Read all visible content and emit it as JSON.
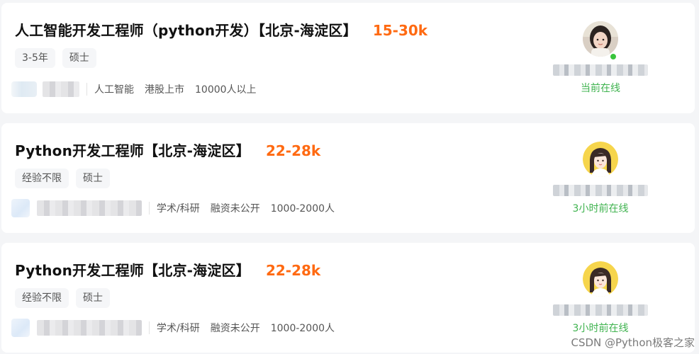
{
  "jobs": [
    {
      "title": "人工智能开发工程师（python开发）【北京-海淀区】",
      "salary": "15-30k",
      "tags": [
        "3-5年",
        "硕士"
      ],
      "company_meta": [
        "人工智能",
        "港股上市",
        "10000人以上"
      ],
      "recruiter_status": "当前在线",
      "recruiter_online": true
    },
    {
      "title": "Python开发工程师【北京-海淀区】",
      "salary": "22-28k",
      "tags": [
        "经验不限",
        "硕士"
      ],
      "company_meta": [
        "学术/科研",
        "融资未公开",
        "1000-2000人"
      ],
      "recruiter_status": "3小时前在线",
      "recruiter_online": false
    },
    {
      "title": "Python开发工程师【北京-海淀区】",
      "salary": "22-28k",
      "tags": [
        "经验不限",
        "硕士"
      ],
      "company_meta": [
        "学术/科研",
        "融资未公开",
        "1000-2000人"
      ],
      "recruiter_status": "3小时前在线",
      "recruiter_online": false
    }
  ],
  "colors": {
    "salary": "#ff6a12",
    "status_green": "#3fb34f",
    "tag_bg": "#f5f6f8",
    "card_bg": "#ffffff",
    "page_bg": "#f4f5f7"
  },
  "watermark": "CSDN @Python极客之家"
}
